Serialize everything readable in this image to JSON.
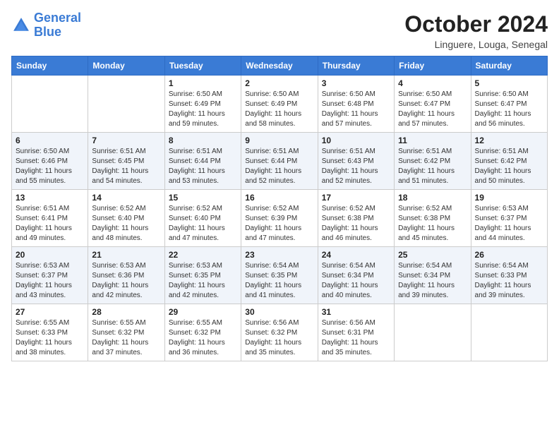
{
  "header": {
    "logo_line1": "General",
    "logo_line2": "Blue",
    "month": "October 2024",
    "location": "Linguere, Louga, Senegal"
  },
  "weekdays": [
    "Sunday",
    "Monday",
    "Tuesday",
    "Wednesday",
    "Thursday",
    "Friday",
    "Saturday"
  ],
  "weeks": [
    [
      {
        "day": "",
        "info": ""
      },
      {
        "day": "",
        "info": ""
      },
      {
        "day": "1",
        "info": "Sunrise: 6:50 AM\nSunset: 6:49 PM\nDaylight: 11 hours and 59 minutes."
      },
      {
        "day": "2",
        "info": "Sunrise: 6:50 AM\nSunset: 6:49 PM\nDaylight: 11 hours and 58 minutes."
      },
      {
        "day": "3",
        "info": "Sunrise: 6:50 AM\nSunset: 6:48 PM\nDaylight: 11 hours and 57 minutes."
      },
      {
        "day": "4",
        "info": "Sunrise: 6:50 AM\nSunset: 6:47 PM\nDaylight: 11 hours and 57 minutes."
      },
      {
        "day": "5",
        "info": "Sunrise: 6:50 AM\nSunset: 6:47 PM\nDaylight: 11 hours and 56 minutes."
      }
    ],
    [
      {
        "day": "6",
        "info": "Sunrise: 6:50 AM\nSunset: 6:46 PM\nDaylight: 11 hours and 55 minutes."
      },
      {
        "day": "7",
        "info": "Sunrise: 6:51 AM\nSunset: 6:45 PM\nDaylight: 11 hours and 54 minutes."
      },
      {
        "day": "8",
        "info": "Sunrise: 6:51 AM\nSunset: 6:44 PM\nDaylight: 11 hours and 53 minutes."
      },
      {
        "day": "9",
        "info": "Sunrise: 6:51 AM\nSunset: 6:44 PM\nDaylight: 11 hours and 52 minutes."
      },
      {
        "day": "10",
        "info": "Sunrise: 6:51 AM\nSunset: 6:43 PM\nDaylight: 11 hours and 52 minutes."
      },
      {
        "day": "11",
        "info": "Sunrise: 6:51 AM\nSunset: 6:42 PM\nDaylight: 11 hours and 51 minutes."
      },
      {
        "day": "12",
        "info": "Sunrise: 6:51 AM\nSunset: 6:42 PM\nDaylight: 11 hours and 50 minutes."
      }
    ],
    [
      {
        "day": "13",
        "info": "Sunrise: 6:51 AM\nSunset: 6:41 PM\nDaylight: 11 hours and 49 minutes."
      },
      {
        "day": "14",
        "info": "Sunrise: 6:52 AM\nSunset: 6:40 PM\nDaylight: 11 hours and 48 minutes."
      },
      {
        "day": "15",
        "info": "Sunrise: 6:52 AM\nSunset: 6:40 PM\nDaylight: 11 hours and 47 minutes."
      },
      {
        "day": "16",
        "info": "Sunrise: 6:52 AM\nSunset: 6:39 PM\nDaylight: 11 hours and 47 minutes."
      },
      {
        "day": "17",
        "info": "Sunrise: 6:52 AM\nSunset: 6:38 PM\nDaylight: 11 hours and 46 minutes."
      },
      {
        "day": "18",
        "info": "Sunrise: 6:52 AM\nSunset: 6:38 PM\nDaylight: 11 hours and 45 minutes."
      },
      {
        "day": "19",
        "info": "Sunrise: 6:53 AM\nSunset: 6:37 PM\nDaylight: 11 hours and 44 minutes."
      }
    ],
    [
      {
        "day": "20",
        "info": "Sunrise: 6:53 AM\nSunset: 6:37 PM\nDaylight: 11 hours and 43 minutes."
      },
      {
        "day": "21",
        "info": "Sunrise: 6:53 AM\nSunset: 6:36 PM\nDaylight: 11 hours and 42 minutes."
      },
      {
        "day": "22",
        "info": "Sunrise: 6:53 AM\nSunset: 6:35 PM\nDaylight: 11 hours and 42 minutes."
      },
      {
        "day": "23",
        "info": "Sunrise: 6:54 AM\nSunset: 6:35 PM\nDaylight: 11 hours and 41 minutes."
      },
      {
        "day": "24",
        "info": "Sunrise: 6:54 AM\nSunset: 6:34 PM\nDaylight: 11 hours and 40 minutes."
      },
      {
        "day": "25",
        "info": "Sunrise: 6:54 AM\nSunset: 6:34 PM\nDaylight: 11 hours and 39 minutes."
      },
      {
        "day": "26",
        "info": "Sunrise: 6:54 AM\nSunset: 6:33 PM\nDaylight: 11 hours and 39 minutes."
      }
    ],
    [
      {
        "day": "27",
        "info": "Sunrise: 6:55 AM\nSunset: 6:33 PM\nDaylight: 11 hours and 38 minutes."
      },
      {
        "day": "28",
        "info": "Sunrise: 6:55 AM\nSunset: 6:32 PM\nDaylight: 11 hours and 37 minutes."
      },
      {
        "day": "29",
        "info": "Sunrise: 6:55 AM\nSunset: 6:32 PM\nDaylight: 11 hours and 36 minutes."
      },
      {
        "day": "30",
        "info": "Sunrise: 6:56 AM\nSunset: 6:32 PM\nDaylight: 11 hours and 35 minutes."
      },
      {
        "day": "31",
        "info": "Sunrise: 6:56 AM\nSunset: 6:31 PM\nDaylight: 11 hours and 35 minutes."
      },
      {
        "day": "",
        "info": ""
      },
      {
        "day": "",
        "info": ""
      }
    ]
  ]
}
